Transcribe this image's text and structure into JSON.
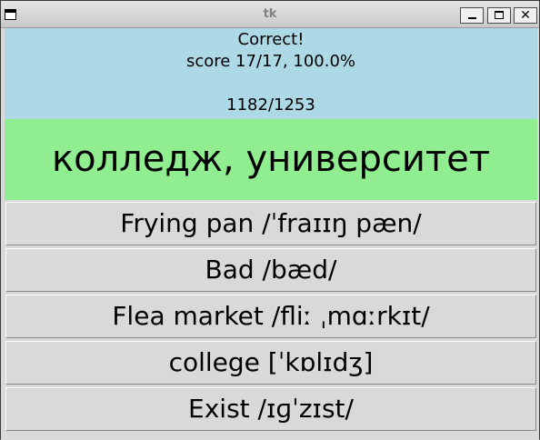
{
  "window": {
    "title": "tk",
    "buttons": {
      "close_glyph": "✕"
    }
  },
  "status": {
    "result": "Correct!",
    "score": "score 17/17, 100.0%",
    "progress": "1182/1253"
  },
  "prompt_word": "колледж, университет",
  "choices": [
    {
      "label": "Frying pan /ˈfraɪɪŋ pæn/"
    },
    {
      "label": "Bad /bæd/"
    },
    {
      "label": "Flea market /fliː ˌmɑːrkɪt/"
    },
    {
      "label": "college [ˈkɒlɪdʒ]"
    },
    {
      "label": "Exist /ɪɡˈzɪst/"
    }
  ],
  "colors": {
    "status_bg": "#add8e6",
    "word_bg": "#90ee90",
    "button_bg": "#d9d9d9"
  }
}
